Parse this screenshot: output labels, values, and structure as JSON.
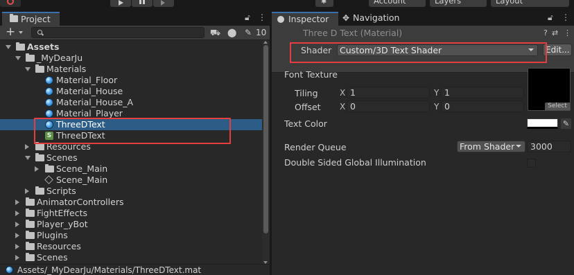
{
  "toolbar": {
    "account_label": "Account",
    "layers_label": "Layers",
    "layout_label": "Layout"
  },
  "project": {
    "tab_label": "Project",
    "search": {
      "value": "",
      "placeholder": ""
    },
    "hidden_count": "10",
    "tree": [
      {
        "label": "Assets",
        "kind": "folder",
        "state": "open",
        "bold": true
      },
      {
        "label": "_MyDearJu",
        "kind": "folder",
        "state": "open"
      },
      {
        "label": "Materials",
        "kind": "folder",
        "state": "open"
      },
      {
        "label": "Material_Floor",
        "kind": "material"
      },
      {
        "label": "Material_House",
        "kind": "material"
      },
      {
        "label": "Material_House_A",
        "kind": "material"
      },
      {
        "label": "Material_Player",
        "kind": "material"
      },
      {
        "label": "ThreeDText",
        "kind": "material",
        "selected": true
      },
      {
        "label": "ThreeDText",
        "kind": "shader"
      },
      {
        "label": "Resources",
        "kind": "folder",
        "state": "closed"
      },
      {
        "label": "Scenes",
        "kind": "folder",
        "state": "open"
      },
      {
        "label": "Scene_Main",
        "kind": "folder",
        "state": "closed"
      },
      {
        "label": "Scene_Main",
        "kind": "scene"
      },
      {
        "label": "Scripts",
        "kind": "folder",
        "state": "closed"
      },
      {
        "label": "AnimatorControllers",
        "kind": "folder",
        "state": "closed"
      },
      {
        "label": "FightEffects",
        "kind": "folder",
        "state": "closed"
      },
      {
        "label": "Player_yBot",
        "kind": "folder",
        "state": "closed"
      },
      {
        "label": "Plugins",
        "kind": "folder",
        "state": "closed"
      },
      {
        "label": "Resources",
        "kind": "folder",
        "state": "closed"
      },
      {
        "label": "Scenes",
        "kind": "folder",
        "state": "closed"
      }
    ],
    "path": "Assets/_MyDearJu/Materials/ThreeDText.mat"
  },
  "inspector": {
    "tab_inspector": "Inspector",
    "tab_navigation": "Navigation",
    "material_title": "Three D Text (Material)",
    "shader_label": "Shader",
    "shader_value": "Custom/3D Text Shader",
    "edit_label": "Edit...",
    "font_texture_label": "Font Texture",
    "tiling_label": "Tiling",
    "offset_label": "Offset",
    "x_label": "X",
    "y_label": "Y",
    "tiling_x": "1",
    "tiling_y": "1",
    "offset_x": "0",
    "offset_y": "0",
    "texture_select_label": "Select",
    "text_color_label": "Text Color",
    "text_color_value": "#ffffff",
    "render_queue_label": "Render Queue",
    "render_queue_mode": "From Shader",
    "render_queue_value": "3000",
    "dsgi_label": "Double Sided Global Illumination",
    "dsgi_checked": false
  },
  "colors": {
    "selection": "#2c5d87",
    "highlight_box": "#e53e3e",
    "tab_accent": "#3a72b0"
  }
}
